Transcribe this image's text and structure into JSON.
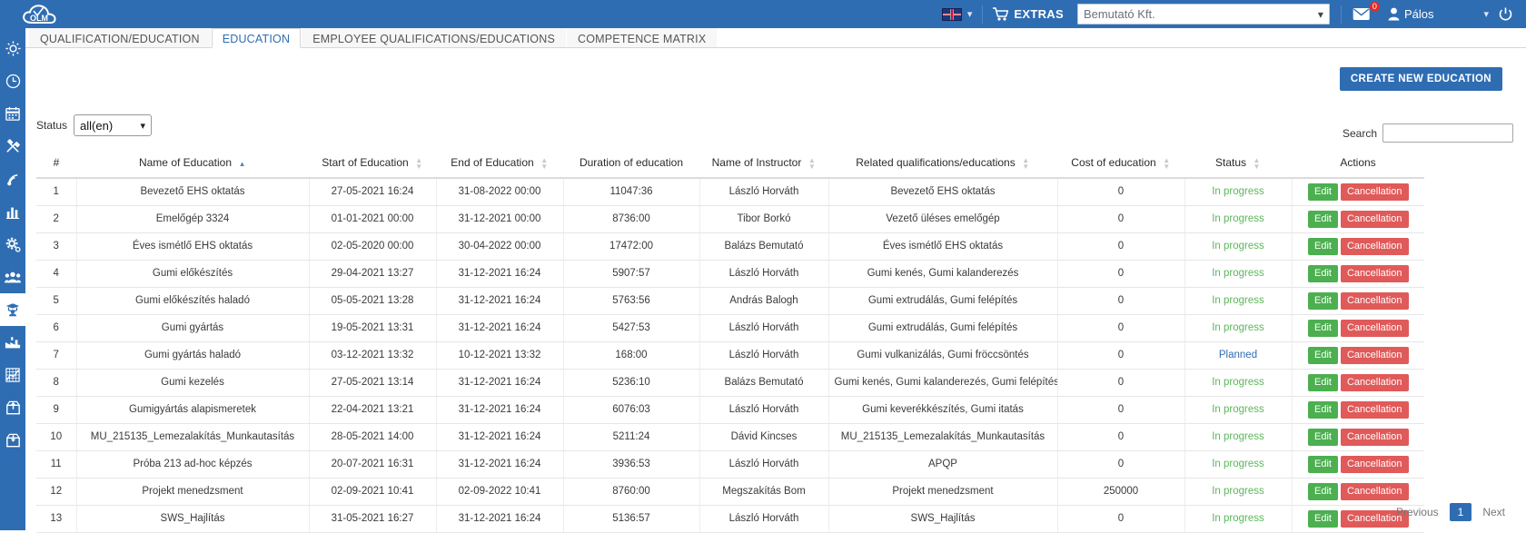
{
  "topbar": {
    "logo_text": "OLM",
    "language_flag": "uk-flag-icon",
    "extras_label": "EXTRAS",
    "company_value": "Bemutató Kft.",
    "mail_badge": "0",
    "user_name": "Pálos",
    "power_icon": "power-icon"
  },
  "sidebar": {
    "items": [
      {
        "icon": "sun-icon",
        "active": false
      },
      {
        "icon": "clock-icon",
        "active": false
      },
      {
        "icon": "calendar-icon",
        "active": false
      },
      {
        "icon": "tools-icon",
        "active": false
      },
      {
        "icon": "signal-icon",
        "active": false
      },
      {
        "icon": "bar-chart-icon",
        "active": false
      },
      {
        "icon": "gear-icon",
        "active": false
      },
      {
        "icon": "people-icon",
        "active": false
      },
      {
        "icon": "graduation-user-icon",
        "active": true
      },
      {
        "icon": "factory-icon",
        "active": false
      },
      {
        "icon": "grid-chart-icon",
        "active": false
      },
      {
        "icon": "inbox-up-icon",
        "active": false
      },
      {
        "icon": "inbox-down-icon",
        "active": false
      }
    ]
  },
  "tabs": [
    {
      "label": "QUALIFICATION/EDUCATION",
      "active": false
    },
    {
      "label": "EDUCATION",
      "active": true
    },
    {
      "label": "EMPLOYEE QUALIFICATIONS/EDUCATIONS",
      "active": false
    },
    {
      "label": "COMPETENCE MATRIX",
      "active": false
    }
  ],
  "toolbar": {
    "create_label": "CREATE NEW EDUCATION",
    "status_label": "Status",
    "status_value": "all(en)",
    "status_options": [
      "all(en)"
    ],
    "search_label": "Search",
    "search_value": "",
    "search_placeholder": ""
  },
  "table": {
    "columns": [
      {
        "key": "num",
        "label": "#",
        "sortable": false
      },
      {
        "key": "name",
        "label": "Name of Education",
        "sortable": true,
        "sorted": "asc"
      },
      {
        "key": "start",
        "label": "Start of Education",
        "sortable": true
      },
      {
        "key": "end",
        "label": "End of Education",
        "sortable": true
      },
      {
        "key": "duration",
        "label": "Duration of education",
        "sortable": false
      },
      {
        "key": "instructor",
        "label": "Name of Instructor",
        "sortable": true
      },
      {
        "key": "related",
        "label": "Related qualifications/educations",
        "sortable": true
      },
      {
        "key": "cost",
        "label": "Cost of education",
        "sortable": true
      },
      {
        "key": "status",
        "label": "Status",
        "sortable": true
      },
      {
        "key": "actions",
        "label": "Actions",
        "sortable": false
      }
    ],
    "row_actions": {
      "edit": "Edit",
      "cancel": "Cancellation"
    },
    "rows": [
      {
        "num": "1",
        "name": "Bevezető EHS oktatás",
        "start": "27-05-2021 16:24",
        "end": "31-08-2022 00:00",
        "duration": "11047:36",
        "instructor": "László Horváth",
        "related": "Bevezető EHS oktatás",
        "cost": "0",
        "status": "In progress"
      },
      {
        "num": "2",
        "name": "Emelőgép 3324",
        "start": "01-01-2021 00:00",
        "end": "31-12-2021 00:00",
        "duration": "8736:00",
        "instructor": "Tibor Borkó",
        "related": "Vezető üléses emelőgép",
        "cost": "0",
        "status": "In progress"
      },
      {
        "num": "3",
        "name": "Éves ismétlő EHS oktatás",
        "start": "02-05-2020 00:00",
        "end": "30-04-2022 00:00",
        "duration": "17472:00",
        "instructor": "Balázs Bemutató",
        "related": "Éves ismétlő EHS oktatás",
        "cost": "0",
        "status": "In progress"
      },
      {
        "num": "4",
        "name": "Gumi előkészítés",
        "start": "29-04-2021 13:27",
        "end": "31-12-2021 16:24",
        "duration": "5907:57",
        "instructor": "László Horváth",
        "related": "Gumi kenés, Gumi kalanderezés",
        "cost": "0",
        "status": "In progress"
      },
      {
        "num": "5",
        "name": "Gumi előkészítés haladó",
        "start": "05-05-2021 13:28",
        "end": "31-12-2021 16:24",
        "duration": "5763:56",
        "instructor": "András Balogh",
        "related": "Gumi extrudálás, Gumi felépítés",
        "cost": "0",
        "status": "In progress"
      },
      {
        "num": "6",
        "name": "Gumi gyártás",
        "start": "19-05-2021 13:31",
        "end": "31-12-2021 16:24",
        "duration": "5427:53",
        "instructor": "László Horváth",
        "related": "Gumi extrudálás, Gumi felépítés",
        "cost": "0",
        "status": "In progress"
      },
      {
        "num": "7",
        "name": "Gumi gyártás haladó",
        "start": "03-12-2021 13:32",
        "end": "10-12-2021 13:32",
        "duration": "168:00",
        "instructor": "László Horváth",
        "related": "Gumi vulkanizálás, Gumi fröccsöntés",
        "cost": "0",
        "status": "Planned"
      },
      {
        "num": "8",
        "name": "Gumi kezelés",
        "start": "27-05-2021 13:14",
        "end": "31-12-2021 16:24",
        "duration": "5236:10",
        "instructor": "Balázs Bemutató",
        "related": "Gumi kenés, Gumi kalanderezés, Gumi felépítés",
        "cost": "0",
        "status": "In progress"
      },
      {
        "num": "9",
        "name": "Gumigyártás alapismeretek",
        "start": "22-04-2021 13:21",
        "end": "31-12-2021 16:24",
        "duration": "6076:03",
        "instructor": "László Horváth",
        "related": "Gumi keverékkészítés, Gumi itatás",
        "cost": "0",
        "status": "In progress"
      },
      {
        "num": "10",
        "name": "MU_215135_Lemezalakítás_Munkautasítás",
        "start": "28-05-2021 14:00",
        "end": "31-12-2021 16:24",
        "duration": "5211:24",
        "instructor": "Dávid Kincses",
        "related": "MU_215135_Lemezalakítás_Munkautasítás",
        "cost": "0",
        "status": "In progress"
      },
      {
        "num": "11",
        "name": "Próba 213 ad-hoc képzés",
        "start": "20-07-2021 16:31",
        "end": "31-12-2021 16:24",
        "duration": "3936:53",
        "instructor": "László Horváth",
        "related": "APQP",
        "cost": "0",
        "status": "In progress"
      },
      {
        "num": "12",
        "name": "Projekt menedzsment",
        "start": "02-09-2021 10:41",
        "end": "02-09-2022 10:41",
        "duration": "8760:00",
        "instructor": "Megszakítás Bom",
        "related": "Projekt menedzsment",
        "cost": "250000",
        "status": "In progress"
      },
      {
        "num": "13",
        "name": "SWS_Hajlítás",
        "start": "31-05-2021 16:27",
        "end": "31-12-2021 16:24",
        "duration": "5136:57",
        "instructor": "László Horváth",
        "related": "SWS_Hajlítás",
        "cost": "0",
        "status": "In progress"
      }
    ]
  },
  "pagination": {
    "previous": "Previous",
    "current_page": "1",
    "next": "Next"
  },
  "colors": {
    "brand_blue": "#2f6db3",
    "status_in_progress": "#5bb75b",
    "status_planned": "#2f6db3",
    "edit_green": "#4caf50",
    "cancel_red": "#e05a5a"
  }
}
